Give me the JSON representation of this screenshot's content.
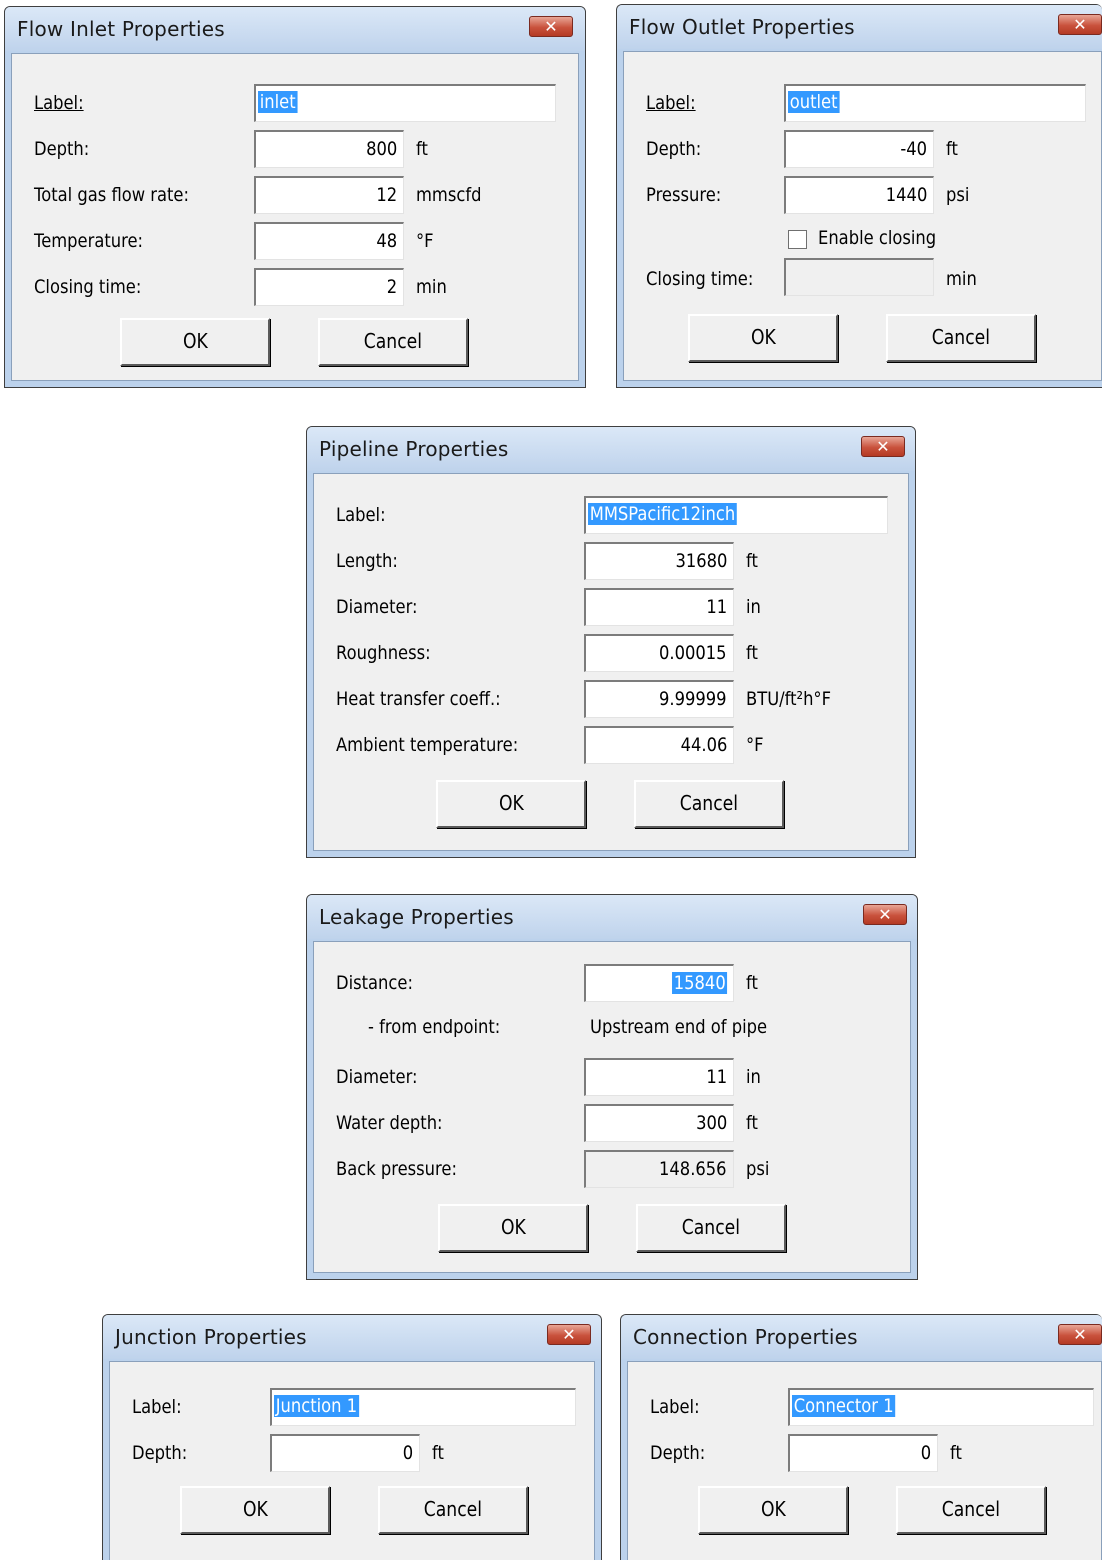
{
  "close_glyph": "✕",
  "flow_inlet": {
    "title": "Flow Inlet Properties",
    "label_caption": "Label:",
    "label_value": "inlet",
    "depth_caption": "Depth:",
    "depth_value": "800",
    "depth_unit": "ft",
    "flow_caption": "Total gas flow rate:",
    "flow_value": "12",
    "flow_unit": "mmscfd",
    "temp_caption": "Temperature:",
    "temp_value": "48",
    "temp_unit": "°F",
    "closing_caption": "Closing time:",
    "closing_value": "2",
    "closing_unit": "min",
    "ok": "OK",
    "cancel": "Cancel"
  },
  "flow_outlet": {
    "title": "Flow Outlet Properties",
    "label_caption": "Label:",
    "label_value": "outlet",
    "depth_caption": "Depth:",
    "depth_value": "-40",
    "depth_unit": "ft",
    "pressure_caption": "Pressure:",
    "pressure_value": "1440",
    "pressure_unit": "psi",
    "enable_closing": "Enable closing",
    "closing_caption": "Closing time:",
    "closing_value": "",
    "closing_unit": "min",
    "ok": "OK",
    "cancel": "Cancel"
  },
  "pipeline": {
    "title": "Pipeline Properties",
    "label_caption": "Label:",
    "label_value": "MMSPacific12inch",
    "length_caption": "Length:",
    "length_value": "31680",
    "length_unit": "ft",
    "diameter_caption": "Diameter:",
    "diameter_value": "11",
    "diameter_unit": "in",
    "roughness_caption": "Roughness:",
    "roughness_value": "0.00015",
    "roughness_unit": "ft",
    "heat_caption": "Heat transfer coeff.:",
    "heat_value": "9.99999",
    "heat_unit": "BTU/ft²h°F",
    "ambient_caption": "Ambient temperature:",
    "ambient_value": "44.06",
    "ambient_unit": "°F",
    "ok": "OK",
    "cancel": "Cancel"
  },
  "leakage": {
    "title": "Leakage Properties",
    "distance_caption": "Distance:",
    "distance_value": "15840",
    "distance_unit": "ft",
    "from_caption": "- from endpoint:",
    "from_value": "Upstream end of pipe",
    "diameter_caption": "Diameter:",
    "diameter_value": "11",
    "diameter_unit": "in",
    "water_caption": "Water depth:",
    "water_value": "300",
    "water_unit": "ft",
    "back_caption": "Back pressure:",
    "back_value": "148.656",
    "back_unit": "psi",
    "ok": "OK",
    "cancel": "Cancel"
  },
  "junction": {
    "title": "Junction Properties",
    "label_caption": "Label:",
    "label_value": "Junction 1",
    "depth_caption": "Depth:",
    "depth_value": "0",
    "depth_unit": "ft",
    "ok": "OK",
    "cancel": "Cancel"
  },
  "connection": {
    "title": "Connection Properties",
    "label_caption": "Label:",
    "label_value": "Connector 1",
    "depth_caption": "Depth:",
    "depth_value": "0",
    "depth_unit": "ft",
    "ok": "OK",
    "cancel": "Cancel"
  }
}
